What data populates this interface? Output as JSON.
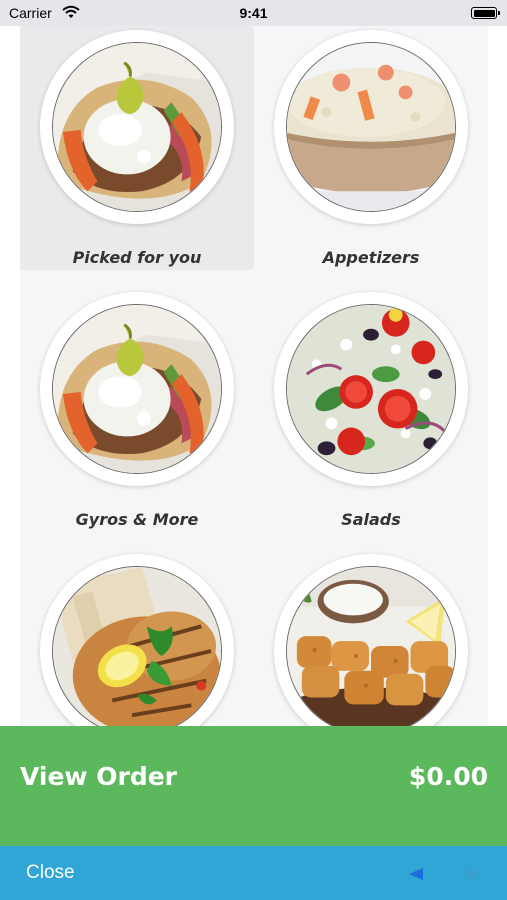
{
  "status_bar": {
    "carrier": "Carrier",
    "time": "9:41",
    "icons": [
      "wifi-icon",
      "battery-icon"
    ]
  },
  "categories": [
    {
      "label": "Picked for you",
      "photo": "gyro-with-pepperoncini",
      "selected": true
    },
    {
      "label": "Appetizers",
      "photo": "bowl-of-dip",
      "selected": false
    },
    {
      "label": "Gyros & More",
      "photo": "gyro-with-pepperoncini",
      "selected": false
    },
    {
      "label": "Salads",
      "photo": "greek-salad",
      "selected": false
    },
    {
      "label": "",
      "photo": "grilled-chicken-with-lemon",
      "selected": false
    },
    {
      "label": "",
      "photo": "fried-bites-with-dip",
      "selected": false
    }
  ],
  "order_bar": {
    "label": "View Order",
    "total": "$0.00"
  },
  "toolbar": {
    "close_label": "Close",
    "icons": [
      "back-arrow-icon",
      "forward-arrow-icon"
    ]
  },
  "colors": {
    "order_bar": "#5cb85c",
    "toolbar": "#2fa6d5",
    "grid_background": "#f4f6f8",
    "selected_tile": "#e9eaec"
  }
}
